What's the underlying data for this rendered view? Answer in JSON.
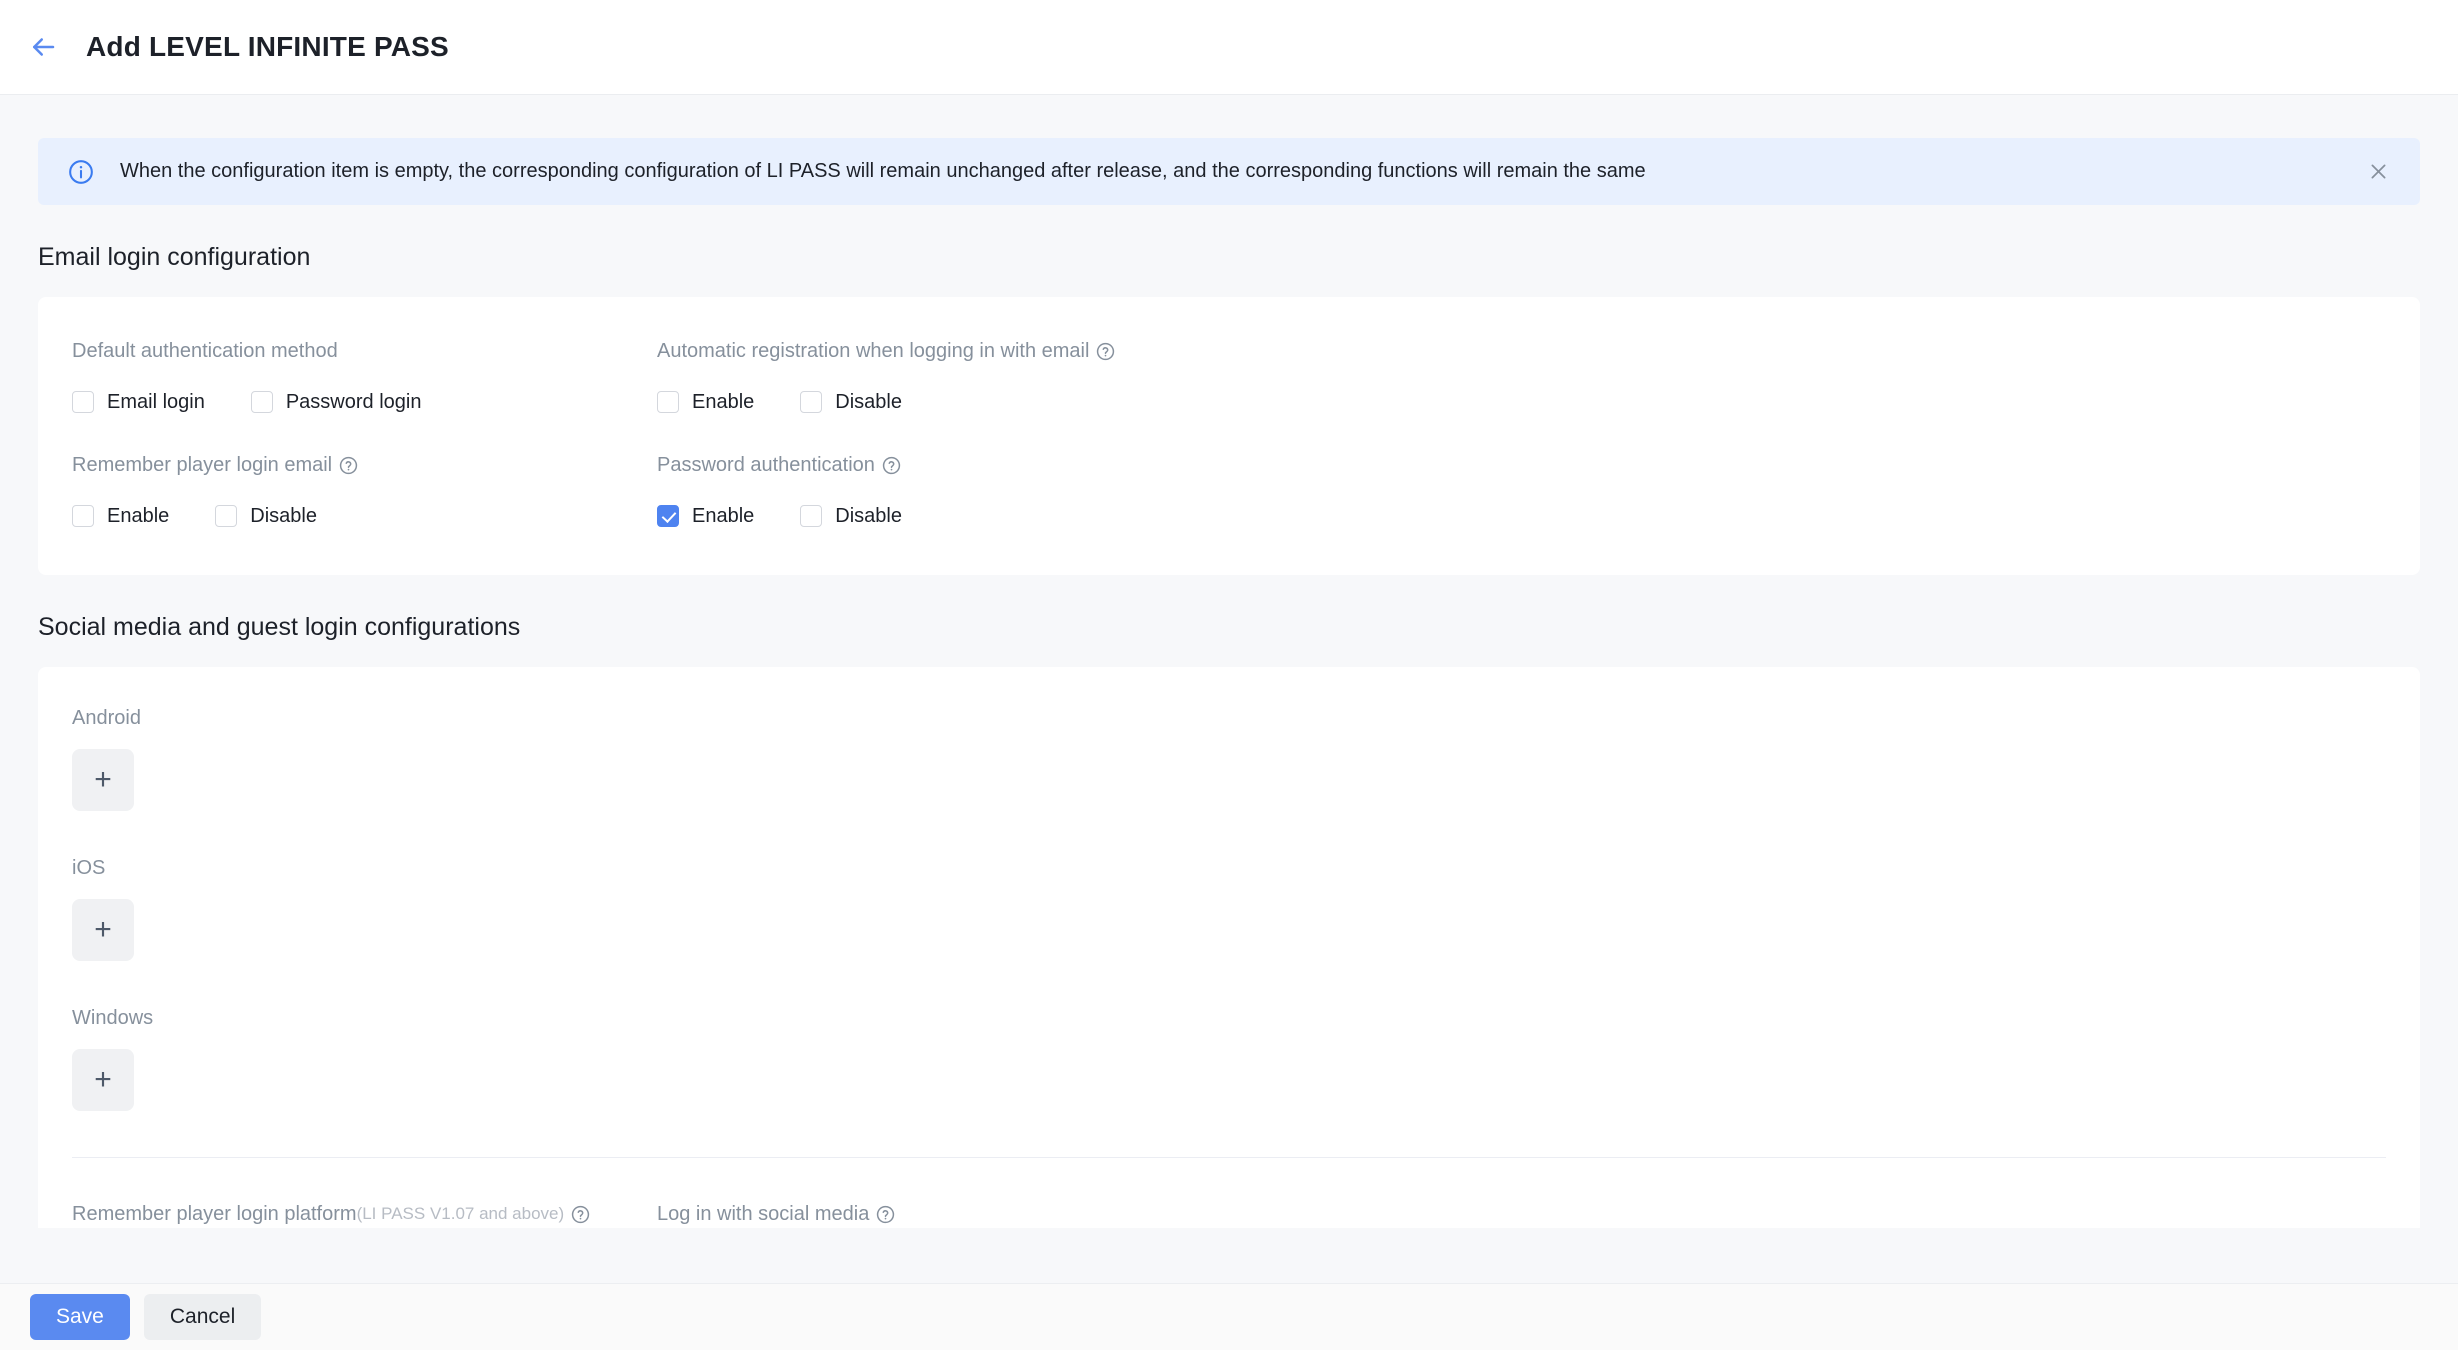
{
  "header": {
    "back_icon": "arrow-left-icon",
    "title": "Add LEVEL INFINITE PASS"
  },
  "alert": {
    "icon": "info-circle-icon",
    "message": "When the configuration item is empty, the corresponding configuration of LI PASS will remain unchanged after release, and the corresponding functions will remain the same",
    "close_icon": "close-icon",
    "background_color": "#e8f0fe",
    "icon_color": "#4e83f0"
  },
  "sections": {
    "email": {
      "heading": "Email login configuration",
      "fields": [
        {
          "label": "Default authentication method",
          "has_help": false,
          "options": [
            {
              "label": "Email login",
              "checked": false
            },
            {
              "label": "Password login",
              "checked": false
            }
          ]
        },
        {
          "label": "Automatic registration when logging in with email",
          "has_help": true,
          "options": [
            {
              "label": "Enable",
              "checked": false
            },
            {
              "label": "Disable",
              "checked": false
            }
          ]
        },
        {
          "label": "Remember player login email",
          "has_help": true,
          "options": [
            {
              "label": "Enable",
              "checked": false
            },
            {
              "label": "Disable",
              "checked": false
            }
          ]
        },
        {
          "label": "Password authentication",
          "has_help": true,
          "options": [
            {
              "label": "Enable",
              "checked": true
            },
            {
              "label": "Disable",
              "checked": false
            }
          ]
        }
      ]
    },
    "social": {
      "heading": "Social media and guest login configurations",
      "platforms": [
        {
          "label": "Android",
          "add_label": "+"
        },
        {
          "label": "iOS",
          "add_label": "+"
        },
        {
          "label": "Windows",
          "add_label": "+"
        }
      ],
      "bottom_fields": [
        {
          "label": "Remember player login platform",
          "sub_label": "(LI PASS V1.07 and above)",
          "has_help": true
        },
        {
          "label": "Log in with social media",
          "sub_label": "",
          "has_help": true
        }
      ]
    }
  },
  "footer": {
    "save_label": "Save",
    "cancel_label": "Cancel",
    "primary_color": "#5a8af0"
  }
}
